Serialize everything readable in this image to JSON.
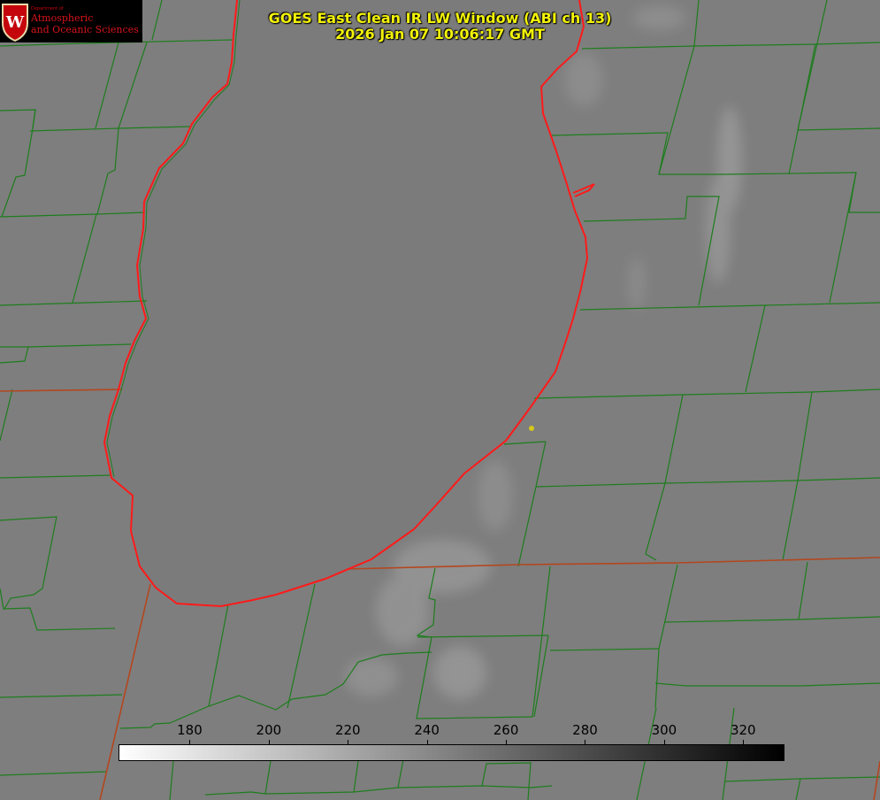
{
  "title": {
    "line1": "GOES East Clean IR LW Window (ABI ch 13)",
    "line2": "2026 Jan 07 10:06:17 GMT"
  },
  "logo": {
    "department": "Department of",
    "name_line1": "Atmospheric",
    "name_line2": "and Oceanic Sciences",
    "crest_letter": "W",
    "color": "#c5050c"
  },
  "colorbar": {
    "min": 162,
    "max": 330,
    "ticks": [
      180,
      200,
      220,
      240,
      260,
      280,
      300,
      320
    ],
    "ramp": [
      "#ffffff",
      "#000000"
    ]
  },
  "colors": {
    "county_lines": "#1e7d1e",
    "coastline": "#ff1a1a",
    "state_lines": "#b4461e",
    "station_marker": "#d6c81a",
    "title_text": "#f2f20a"
  },
  "icons": {
    "logo_crest": "crest-icon",
    "station_marker": "station-dot-icon"
  }
}
